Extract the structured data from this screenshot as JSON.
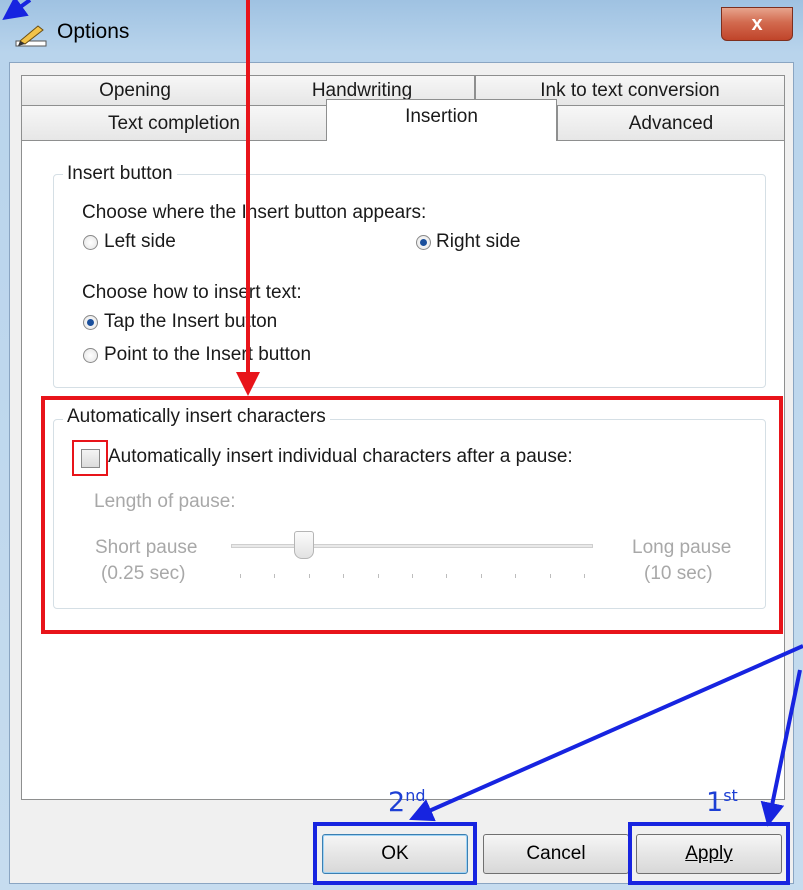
{
  "window": {
    "title": "Options",
    "close_glyph": "x",
    "title_icon": "pen-icon"
  },
  "tabs": {
    "row1": [
      {
        "label": "Opening"
      },
      {
        "label": "Handwriting"
      },
      {
        "label": "Ink to text conversion"
      }
    ],
    "row2": [
      {
        "label": "Text completion"
      },
      {
        "label": "Insertion",
        "active": true
      },
      {
        "label": "Advanced"
      }
    ]
  },
  "insert_button_group": {
    "title": "Insert button",
    "where_prompt": "Choose where the Insert button appears:",
    "left_side": "Left side",
    "right_side": "Right side",
    "selected_side": "Right side",
    "how_prompt": "Choose how to insert text:",
    "tap": "Tap the Insert button",
    "point": "Point to the Insert button",
    "selected_method": "Tap the Insert button"
  },
  "auto_group": {
    "title": "Automatically insert characters",
    "checkbox_label": "Automatically insert individual characters after a pause:",
    "checked": false,
    "length_label": "Length of pause:",
    "short_label": "Short pause",
    "short_value": "(0.25 sec)",
    "long_label": "Long pause",
    "long_value": "(10 sec)",
    "slider_position_fraction": 0.19
  },
  "buttons": {
    "ok": "OK",
    "cancel": "Cancel",
    "apply": "Apply"
  },
  "annotations": {
    "second": {
      "num": "2",
      "suffix": "nd"
    },
    "first": {
      "num": "1",
      "suffix": "st"
    },
    "red": "#e8141a",
    "blue": "#1724e0"
  }
}
